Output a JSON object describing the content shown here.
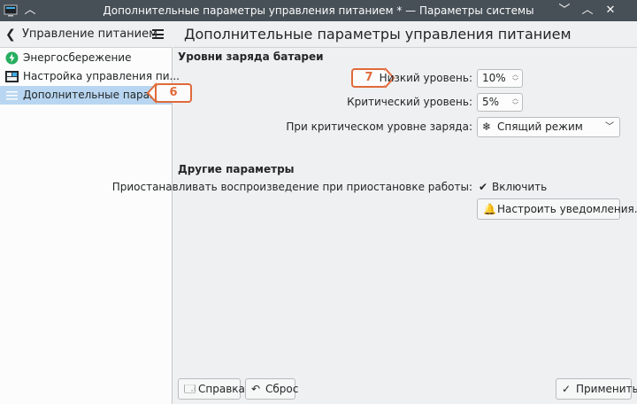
{
  "window": {
    "title": "Дополнительные параметры управления питанием * — Параметры системы"
  },
  "sidebar": {
    "header_title": "Управление питанием",
    "items": [
      {
        "label": "Энергосбережение",
        "icon": "energy-saving-icon"
      },
      {
        "label": "Настройка управления пи...",
        "icon": "activity-settings-icon"
      },
      {
        "label": "Дополнительные парамет...",
        "icon": "advanced-settings-icon",
        "selected": true
      }
    ]
  },
  "content": {
    "header": "Дополнительные параметры управления питанием",
    "battery_group": {
      "title": "Уровни заряда батареи",
      "low_label": "Низкий уровень:",
      "low_value": "10%",
      "critical_label": "Критический уровень:",
      "critical_value": "5%",
      "action_label": "При критическом уровне заряда:",
      "action_value": "Спящий режим"
    },
    "other_group": {
      "title": "Другие параметры",
      "pause_label": "Приостанавливать воспроизведение при приостановке работы:",
      "pause_checkbox_label": "Включить",
      "notifications_button": "Настроить уведомления..."
    }
  },
  "footer": {
    "help_label": "Справка",
    "reset_label": "Сброс",
    "apply_label": "Применить"
  },
  "callouts": {
    "six": "6",
    "seven": "7"
  },
  "colors": {
    "accent": "#e06a3a",
    "titlebar": "#475057",
    "selection": "#b8d6f1"
  }
}
